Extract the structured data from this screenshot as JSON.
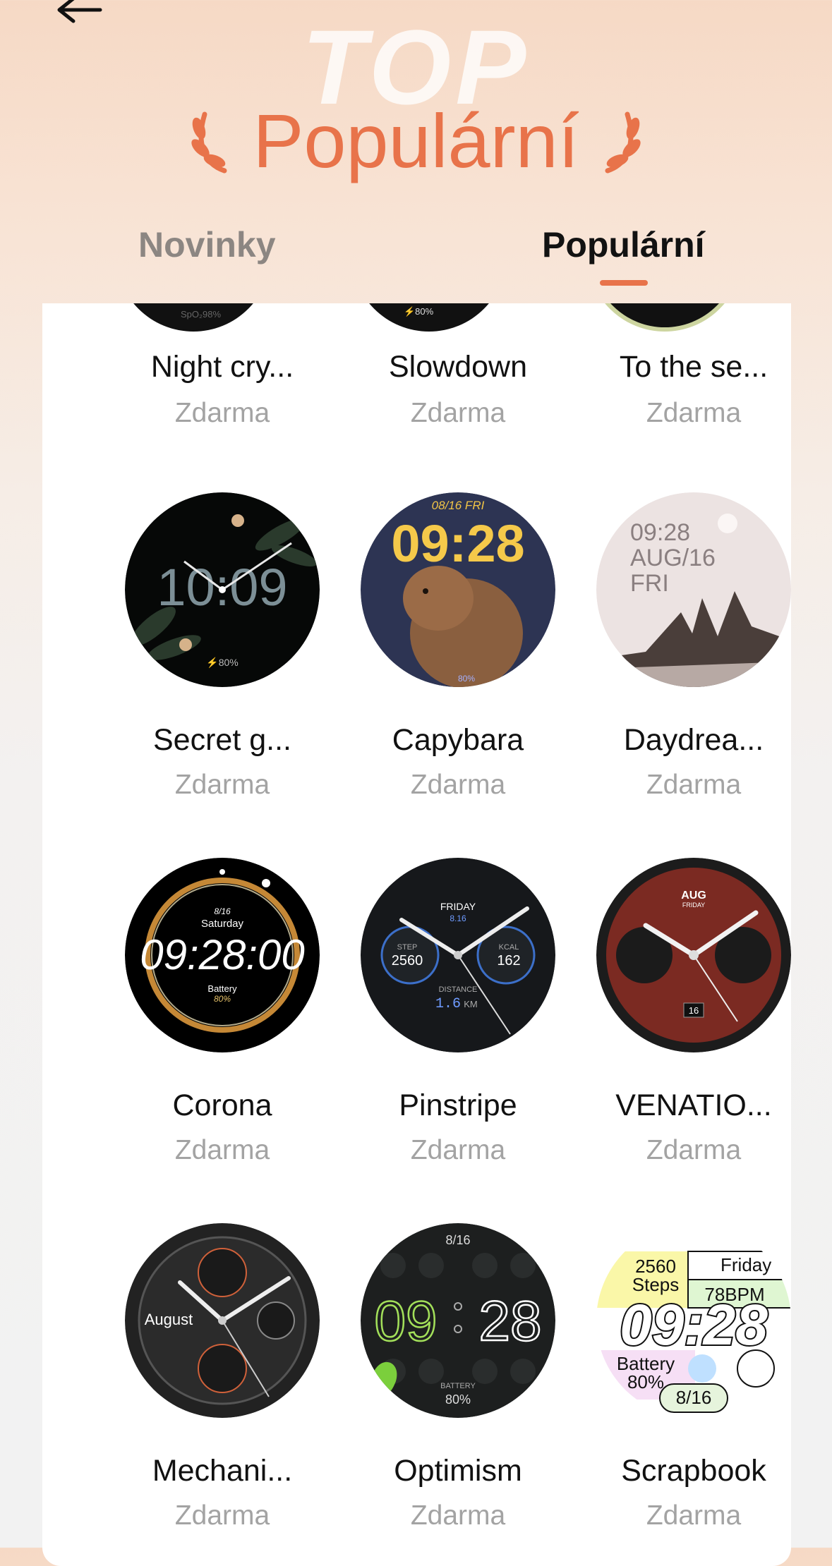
{
  "header": {
    "bg_word": "TOP",
    "title": "Populární"
  },
  "tabs": [
    {
      "label": "Novinky",
      "active": false
    },
    {
      "label": "Populární",
      "active": true
    }
  ],
  "colors": {
    "accent": "#e8734a"
  },
  "row_partial": [
    {
      "name": "Night cry...",
      "price": "Zdarma",
      "face_text": "SpO₂98%"
    },
    {
      "name": "Slowdown",
      "price": "Zdarma",
      "face_text": "⚡80%"
    },
    {
      "name": "To the se...",
      "price": "Zdarma"
    }
  ],
  "faces": [
    {
      "name": "Secret g...",
      "price": "Zdarma",
      "time": "10:09",
      "battery": "⚡80%"
    },
    {
      "name": "Capybara",
      "price": "Zdarma",
      "date": "08/16  FRI",
      "time": "09:28",
      "battery": "80%"
    },
    {
      "name": "Daydrea...",
      "price": "Zdarma",
      "time": "09:28",
      "date": "AUG/16",
      "day": "FRI"
    },
    {
      "name": "Corona",
      "price": "Zdarma",
      "date": "8/16",
      "day": "Saturday",
      "time": "09:28:00",
      "battery_label": "Battery",
      "battery": "80%"
    },
    {
      "name": "Pinstripe",
      "price": "Zdarma",
      "day": "FRIDAY",
      "date": "8.16",
      "step_label": "STEP",
      "step": "2560",
      "kcal_label": "KCAL",
      "kcal": "162",
      "distance_label": "DISTANCE",
      "distance": "1.6",
      "distance_unit": "KM"
    },
    {
      "name": "VENATIO...",
      "price": "Zdarma",
      "month": "AUG",
      "day": "FRIDAY",
      "date": "16"
    },
    {
      "name": "Mechani...",
      "price": "Zdarma",
      "month": "August"
    },
    {
      "name": "Optimism",
      "price": "Zdarma",
      "date": "8/16",
      "hours": "09",
      "minutes": "28",
      "battery_label": "BATTERY",
      "battery": "80%"
    },
    {
      "name": "Scrapbook",
      "price": "Zdarma",
      "day": "Friday",
      "steps": "2560",
      "steps_label": "Steps",
      "bpm": "78BPM",
      "time": "09:28",
      "battery_label": "Battery",
      "battery": "80%",
      "date": "8/16"
    }
  ]
}
